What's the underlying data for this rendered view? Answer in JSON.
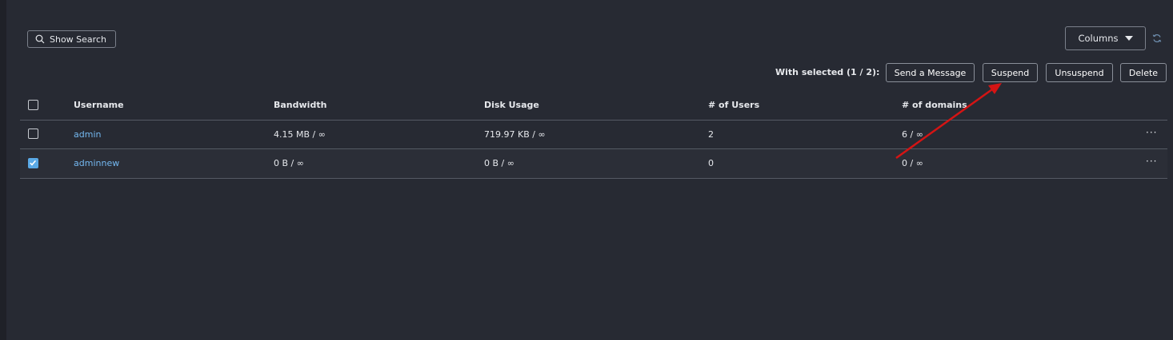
{
  "toolbar": {
    "show_search_label": "Show Search",
    "columns_label": "Columns",
    "with_selected_label": "With selected (1 / 2):",
    "send_message_label": "Send a Message",
    "suspend_label": "Suspend",
    "unsuspend_label": "Unsuspend",
    "delete_label": "Delete"
  },
  "table": {
    "headers": [
      "Username",
      "Bandwidth",
      "Disk Usage",
      "# of Users",
      "# of domains"
    ],
    "rows": [
      {
        "username": "admin",
        "bandwidth": "4.15 MB / ∞",
        "disk_usage": "719.97 KB / ∞",
        "users": "2",
        "domains": "6 / ∞",
        "checked": false,
        "menu": "···"
      },
      {
        "username": "adminnew",
        "bandwidth": "0 B / ∞",
        "disk_usage": "0 B / ∞",
        "users": "0",
        "domains": "0 / ∞",
        "checked": true,
        "menu": "···"
      }
    ]
  },
  "colors": {
    "background": "#272a33",
    "link": "#74b8f0",
    "checkbox_checked": "#5aa9e6",
    "annotation_arrow": "#d41414"
  },
  "icons": [
    "search-icon",
    "caret-down-icon",
    "refresh-icon",
    "checkmark-icon",
    "more-icon",
    "annotation-arrow"
  ]
}
